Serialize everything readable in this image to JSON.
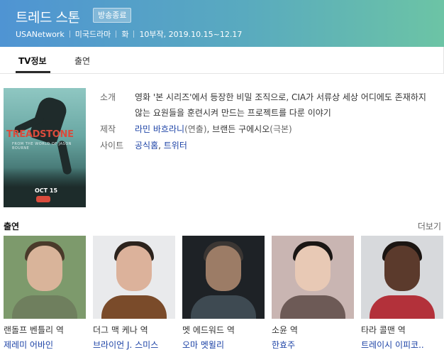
{
  "header": {
    "title": "트레드 스톤",
    "badge": "방송종료",
    "meta": [
      "USANetwork",
      "미국드라마",
      "화",
      "10부작, 2019.10.15~12.17"
    ],
    "colors": {
      "gradient_start": "#4f94d3",
      "gradient_end": "#6cc4a5"
    }
  },
  "tabs": [
    {
      "label": "TV정보",
      "active": true
    },
    {
      "label": "출연",
      "active": false
    }
  ],
  "poster": {
    "logo": "TREADSTONE",
    "tagline": "FROM THE WORLD OF JASON BOURNE",
    "date": "OCT 15",
    "network_icon": "usa-network-logo"
  },
  "info": {
    "intro_label": "소개",
    "intro_text": "영화 '본 시리즈'에서 등장한 비밀 조직으로, CIA가 서류상 세상 어디에도 존재하지 않는 요원들을 훈련시켜 만드는 프로젝트를 다룬 이야기",
    "production_label": "제작",
    "director": "라민 바흐라니",
    "director_role": "(연출)",
    "comma": ", ",
    "writer": "브랜든 구에시오",
    "writer_role": "(극본)",
    "site_label": "사이트",
    "site_links": [
      "공식홈",
      "트위터"
    ]
  },
  "cast": {
    "title": "출연",
    "more_label": "더보기",
    "members": [
      {
        "role": "랜돌프 벤틀리 역",
        "name": "제레미 어바인"
      },
      {
        "role": "더그 맥 케나 역",
        "name": "브라이언 J. 스미스"
      },
      {
        "role": "멧 에드워드 역",
        "name": "오마 멧윌리"
      },
      {
        "role": "소윤 역",
        "name": "한효주"
      },
      {
        "role": "타라 콜맨 역",
        "name": "트레이시 이피코.."
      }
    ]
  }
}
